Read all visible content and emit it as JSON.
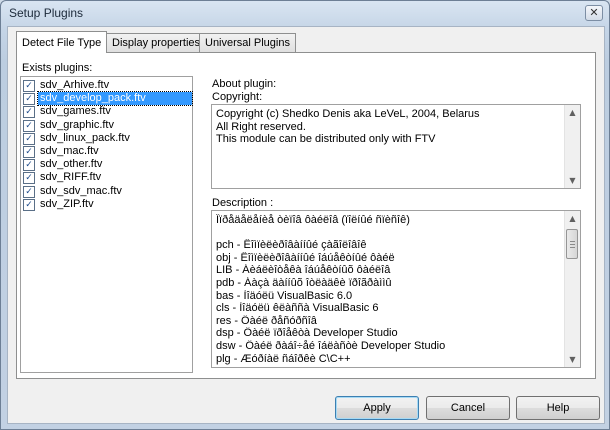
{
  "window": {
    "title": "Setup Plugins",
    "close_glyph": "✕"
  },
  "tabs": [
    {
      "label": "Detect File Type",
      "active": true
    },
    {
      "label": "Display properties",
      "active": false
    },
    {
      "label": "Universal Plugins",
      "active": false
    }
  ],
  "plugins": {
    "label": "Exists plugins:",
    "selected_index": 1,
    "items": [
      {
        "name": "sdv_Arhive.ftv",
        "checked": true
      },
      {
        "name": "sdv_develop_pack.ftv",
        "checked": true
      },
      {
        "name": "sdv_games.ftv",
        "checked": true
      },
      {
        "name": "sdv_graphic.ftv",
        "checked": true
      },
      {
        "name": "sdv_linux_pack.ftv",
        "checked": true
      },
      {
        "name": "sdv_mac.ftv",
        "checked": true
      },
      {
        "name": "sdv_other.ftv",
        "checked": true
      },
      {
        "name": "sdv_RIFF.ftv",
        "checked": true
      },
      {
        "name": "sdv_sdv_mac.ftv",
        "checked": true
      },
      {
        "name": "sdv_ZIP.ftv",
        "checked": true
      }
    ]
  },
  "about": {
    "label": "About plugin:",
    "copyright_label": "Copyright:",
    "copyright_lines": [
      "Copyright (c) Shedko Denis aka LeVeL, 2004, Belarus",
      "All Right reserved.",
      "This module can be distributed only with FTV"
    ],
    "description_label": "Description :",
    "description_lines": [
      "Îïðåäåëåíèå òèïîâ ôàéëîâ (ïîëíûé ñïèñîê)",
      "",
      "pch  - Êîìïèëèðîâàííûé çàãîëîâîê",
      "obj  - Êîìïèëèðîâàííûé îáúåêòíûé ôàéë",
      "LIB  - Áèáëèîòåêà îáúåêòíûõ ôàéëîâ",
      "pdb  - Áàçà äàííûõ îòëàäêè ïðîãðàììû",
      "bas  - Ìîäóëü VisualBasic 6.0",
      "cls  - Ìîäóëü êëàññà VisualBasic 6",
      "res  - Ôàéë ðåñóðñîâ",
      "dsp  - Ôàéë ïðîåêòà Developer Studio",
      "dsw  - Ôàéë ðàáî÷åé îáëàñòè Developer Studio",
      "plg  - Æóðíàë ñáîðêè C\\C++"
    ]
  },
  "buttons": {
    "apply": "Apply",
    "cancel": "Cancel",
    "help": "Help"
  },
  "icons": {
    "check": "✓",
    "scroll_up": "▲",
    "scroll_down": "▼"
  }
}
